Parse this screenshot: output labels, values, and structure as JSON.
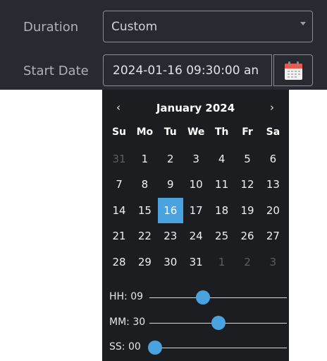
{
  "form": {
    "duration_label": "Duration",
    "duration_value": "Custom",
    "start_date_label": "Start Date",
    "start_date_value": "2024-01-16 09:30:00 an"
  },
  "picker": {
    "prev": "‹",
    "next": "›",
    "month_title": "January 2024",
    "weekdays": [
      "Su",
      "Mo",
      "Tu",
      "We",
      "Th",
      "Fr",
      "Sa"
    ],
    "weeks": [
      [
        "31",
        "1",
        "2",
        "3",
        "4",
        "5",
        "6"
      ],
      [
        "7",
        "8",
        "9",
        "10",
        "11",
        "12",
        "13"
      ],
      [
        "14",
        "15",
        "16",
        "17",
        "18",
        "19",
        "20"
      ],
      [
        "21",
        "22",
        "23",
        "24",
        "25",
        "26",
        "27"
      ],
      [
        "28",
        "29",
        "30",
        "31",
        "1",
        "2",
        "3"
      ]
    ],
    "selected_day": "16",
    "time": {
      "hh_label": "HH: 09",
      "mm_label": "MM: 30",
      "ss_label": "SS: 00",
      "hh_fraction": 0.39,
      "mm_fraction": 0.5,
      "ss_fraction": 0.0
    }
  },
  "colors": {
    "form_bg": "#272a31",
    "picker_bg": "#1c1d21",
    "accent": "#4aa3df"
  },
  "icons": {
    "calendar": "calendar-icon",
    "caret": "caret-down-icon"
  }
}
